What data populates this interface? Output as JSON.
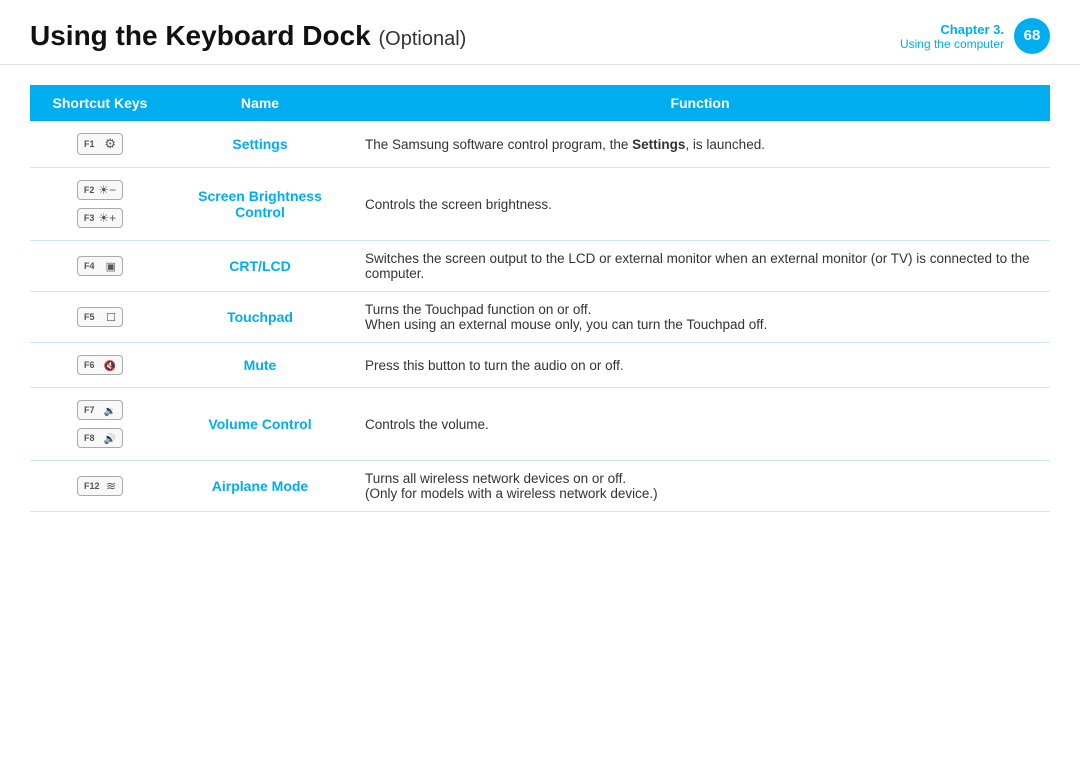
{
  "header": {
    "title_part1": "Using the Keyboard Dock",
    "title_optional": "(Optional)",
    "chapter_label": "Chapter 3.",
    "chapter_sub": "Using the computer",
    "page_number": "68"
  },
  "table": {
    "columns": [
      "Shortcut Keys",
      "Name",
      "Function"
    ],
    "rows": [
      {
        "keys": [
          {
            "label": "F1",
            "icon": "⚙"
          }
        ],
        "name": "Settings",
        "function": "The Samsung software control program, the <b>Settings</b>, is launched.",
        "function_plain": "The Samsung software control program, the Settings, is launched."
      },
      {
        "keys": [
          {
            "label": "F2",
            "icon": "○-"
          },
          {
            "label": "F3",
            "icon": "○+"
          }
        ],
        "name": "Screen Brightness Control",
        "function": "Controls the screen brightness.",
        "function_plain": "Controls the screen brightness."
      },
      {
        "keys": [
          {
            "label": "F4",
            "icon": "▣"
          }
        ],
        "name": "CRT/LCD",
        "function": "Switches the screen output to the LCD or external monitor when an external monitor (or TV) is connected to the computer.",
        "function_plain": "Switches the screen output to the LCD or external monitor when an external monitor (or TV) is connected to the computer."
      },
      {
        "keys": [
          {
            "label": "F5",
            "icon": "✦"
          }
        ],
        "name": "Touchpad",
        "function": "Turns the Touchpad function on or off.\nWhen using an external mouse only, you can turn the Touchpad off.",
        "function_plain": "Turns the Touchpad function on or off.\nWhen using an external mouse only, you can turn the Touchpad off."
      },
      {
        "keys": [
          {
            "label": "F6",
            "icon": "🔇"
          }
        ],
        "name": "Mute",
        "function": "Press this button to turn the audio on or off.",
        "function_plain": "Press this button to turn the audio on or off."
      },
      {
        "keys": [
          {
            "label": "F7",
            "icon": "🔉"
          },
          {
            "label": "F8",
            "icon": "🔊"
          }
        ],
        "name": "Volume Control",
        "function": "Controls the volume.",
        "function_plain": "Controls the volume."
      },
      {
        "keys": [
          {
            "label": "F12",
            "icon": "≋"
          }
        ],
        "name": "Airplane Mode",
        "function": "Turns all wireless network devices on or off.\n(Only for models with a wireless network device.)",
        "function_plain": "Turns all wireless network devices on or off.\n(Only for models with a wireless network device.)"
      }
    ]
  },
  "colors": {
    "accent": "#00aeef",
    "header_bg": "#00aeef",
    "border": "#c8e8f7"
  }
}
